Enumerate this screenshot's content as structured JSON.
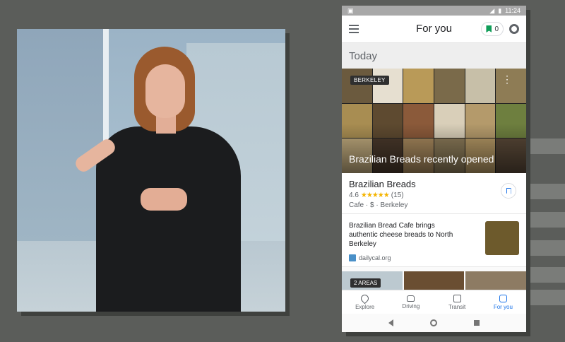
{
  "status_bar": {
    "time": "11:24"
  },
  "app_bar": {
    "title": "For you",
    "saved_count": "0"
  },
  "section": {
    "heading": "Today"
  },
  "collage": {
    "area_chip": "BERKELEY",
    "caption": "Brazilian Breads recently opened"
  },
  "place": {
    "name": "Brazilian Breads",
    "rating": "4.6",
    "stars": "★★★★★",
    "reviews": "(15)",
    "meta": "Cafe · $ · Berkeley"
  },
  "article": {
    "title": "Brazilian Bread Cafe brings authentic cheese breads to North Berkeley",
    "source": "dailycal.org"
  },
  "next_card": {
    "chip": "2 AREAS"
  },
  "bottom_nav": {
    "items": [
      {
        "label": "Explore",
        "icon": "pin-icon"
      },
      {
        "label": "Driving",
        "icon": "car-icon"
      },
      {
        "label": "Transit",
        "icon": "bus-icon"
      },
      {
        "label": "For you",
        "icon": "plus-icon"
      }
    ]
  },
  "colors": {
    "accent": "#1a73e8",
    "saved_flag": "#0f9d58",
    "stars": "#f4b400"
  }
}
